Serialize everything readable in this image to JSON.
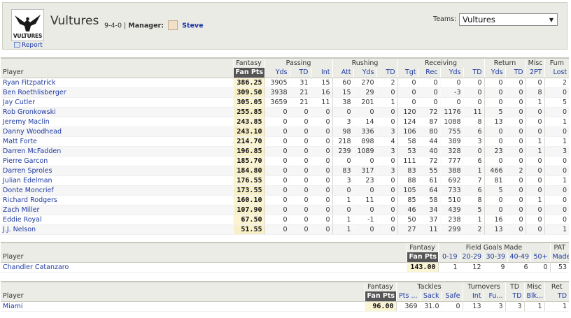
{
  "header": {
    "logo_text": "VULTURES",
    "team_name": "Vultures",
    "record": "9-4-0",
    "manager_label": "Manager:",
    "manager_name": "Steve",
    "report_link": "Report",
    "teams_label": "Teams:",
    "teams_selected": "Vultures"
  },
  "offense": {
    "groups": [
      "Fantasy",
      "Passing",
      "Rushing",
      "Receiving",
      "Return",
      "Misc",
      "Fum"
    ],
    "columns": [
      "Player",
      "Fan Pts",
      "Yds",
      "TD",
      "Int",
      "Att",
      "Yds",
      "TD",
      "Tgt",
      "Rec",
      "Yds",
      "TD",
      "Yds",
      "TD",
      "2PT",
      "Lost"
    ],
    "rows": [
      [
        "Ryan Fitzpatrick",
        "386.25",
        "3905",
        "31",
        "15",
        "60",
        "270",
        "2",
        "0",
        "0",
        "0",
        "0",
        "0",
        "0",
        "0",
        "2"
      ],
      [
        "Ben Roethlisberger",
        "309.50",
        "3938",
        "21",
        "16",
        "15",
        "29",
        "0",
        "0",
        "0",
        "-3",
        "0",
        "0",
        "0",
        "8",
        "0"
      ],
      [
        "Jay Cutler",
        "305.05",
        "3659",
        "21",
        "11",
        "38",
        "201",
        "1",
        "0",
        "0",
        "0",
        "0",
        "0",
        "0",
        "1",
        "5"
      ],
      [
        "Rob Gronkowski",
        "255.85",
        "0",
        "0",
        "0",
        "0",
        "0",
        "0",
        "120",
        "72",
        "1176",
        "11",
        "5",
        "0",
        "0",
        "0"
      ],
      [
        "Jeremy Maclin",
        "243.85",
        "0",
        "0",
        "0",
        "3",
        "14",
        "0",
        "124",
        "87",
        "1088",
        "8",
        "13",
        "0",
        "0",
        "1"
      ],
      [
        "Danny Woodhead",
        "243.10",
        "0",
        "0",
        "0",
        "98",
        "336",
        "3",
        "106",
        "80",
        "755",
        "6",
        "0",
        "0",
        "0",
        "0"
      ],
      [
        "Matt Forte",
        "214.70",
        "0",
        "0",
        "0",
        "218",
        "898",
        "4",
        "58",
        "44",
        "389",
        "3",
        "0",
        "0",
        "1",
        "1"
      ],
      [
        "Darren McFadden",
        "196.85",
        "0",
        "0",
        "0",
        "239",
        "1089",
        "3",
        "53",
        "40",
        "328",
        "0",
        "23",
        "0",
        "1",
        "3"
      ],
      [
        "Pierre Garcon",
        "185.70",
        "0",
        "0",
        "0",
        "0",
        "0",
        "0",
        "111",
        "72",
        "777",
        "6",
        "0",
        "0",
        "0",
        "0"
      ],
      [
        "Darren Sproles",
        "184.80",
        "0",
        "0",
        "0",
        "83",
        "317",
        "3",
        "83",
        "55",
        "388",
        "1",
        "466",
        "2",
        "0",
        "0"
      ],
      [
        "Julian Edelman",
        "176.55",
        "0",
        "0",
        "0",
        "3",
        "23",
        "0",
        "88",
        "61",
        "692",
        "7",
        "81",
        "0",
        "0",
        "1"
      ],
      [
        "Donte Moncrief",
        "173.55",
        "0",
        "0",
        "0",
        "0",
        "0",
        "0",
        "105",
        "64",
        "733",
        "6",
        "5",
        "0",
        "0",
        "0"
      ],
      [
        "Richard Rodgers",
        "160.10",
        "0",
        "0",
        "0",
        "1",
        "11",
        "0",
        "85",
        "58",
        "510",
        "8",
        "0",
        "0",
        "1",
        "0"
      ],
      [
        "Zach Miller",
        "107.90",
        "0",
        "0",
        "0",
        "0",
        "0",
        "0",
        "46",
        "34",
        "439",
        "5",
        "0",
        "0",
        "0",
        "0"
      ],
      [
        "Eddie Royal",
        "67.50",
        "0",
        "0",
        "0",
        "1",
        "-1",
        "0",
        "50",
        "37",
        "238",
        "1",
        "16",
        "0",
        "0",
        "0"
      ],
      [
        "J.J. Nelson",
        "51.55",
        "0",
        "0",
        "0",
        "1",
        "0",
        "0",
        "27",
        "11",
        "299",
        "2",
        "13",
        "0",
        "0",
        "1"
      ]
    ]
  },
  "kicker": {
    "groups": [
      "Fantasy",
      "Field Goals Made",
      "PAT"
    ],
    "columns": [
      "Player",
      "Fan Pts",
      "0-19",
      "20-29",
      "30-39",
      "40-49",
      "50+",
      "Made"
    ],
    "rows": [
      [
        "Chandler Catanzaro",
        "143.00",
        "1",
        "12",
        "9",
        "6",
        "0",
        "53"
      ]
    ]
  },
  "defense": {
    "groups": [
      "Fantasy",
      "Tackles",
      "Turnovers",
      "TD",
      "Misc",
      "Ret"
    ],
    "columns": [
      "Player",
      "Fan Pts",
      "Pts ...",
      "Sack",
      "Safe",
      "Int",
      "Fu...",
      "TD",
      "Blk...",
      "TD"
    ],
    "rows": [
      [
        "Miami",
        "96.00",
        "369",
        "31.0",
        "0",
        "13",
        "3",
        "3",
        "1",
        "1"
      ]
    ]
  }
}
